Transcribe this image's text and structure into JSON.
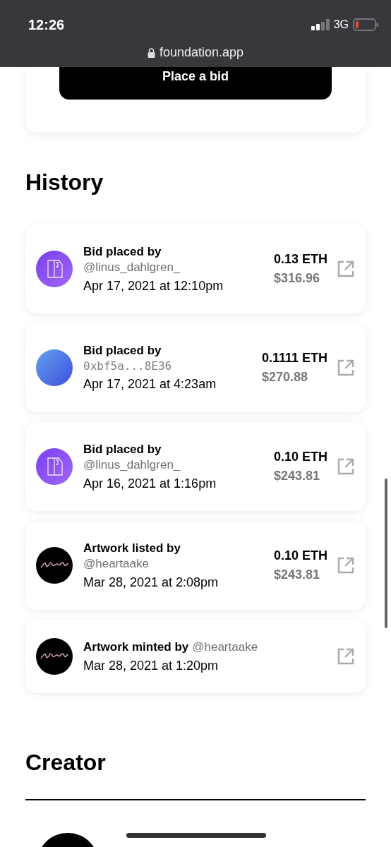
{
  "status_bar": {
    "time": "12:26",
    "network": "3G"
  },
  "browser": {
    "url": "foundation.app"
  },
  "bid_button": {
    "label": "Place a bid"
  },
  "history": {
    "title": "History",
    "items": [
      {
        "kind": "stacked",
        "avatar": {
          "kind": "logo"
        },
        "action": "Bid placed by",
        "actor": {
          "kind": "handle",
          "text": "@linus_dahlgren_"
        },
        "date": "Apr 17, 2021 at 12:10pm",
        "eth": "0.13 ETH",
        "usd": "$316.96"
      },
      {
        "kind": "stacked",
        "avatar": {
          "kind": "gradient"
        },
        "action": "Bid placed by",
        "actor": {
          "kind": "address",
          "text": "0xbf5a...8E36"
        },
        "date": "Apr 17, 2021 at 4:23am",
        "eth": "0.1111 ETH",
        "usd": "$270.88"
      },
      {
        "kind": "stacked",
        "avatar": {
          "kind": "logo"
        },
        "action": "Bid placed by",
        "actor": {
          "kind": "handle",
          "text": "@linus_dahlgren_"
        },
        "date": "Apr 16, 2021 at 1:16pm",
        "eth": "0.10 ETH",
        "usd": "$243.81"
      },
      {
        "kind": "stacked",
        "avatar": {
          "kind": "script"
        },
        "action": "Artwork listed by",
        "actor": {
          "kind": "handle",
          "text": "@heartaake"
        },
        "date": "Mar 28, 2021 at 2:08pm",
        "eth": "0.10 ETH",
        "usd": "$243.81"
      },
      {
        "kind": "inline",
        "avatar": {
          "kind": "script"
        },
        "action": "Artwork minted by",
        "actor": {
          "kind": "handle",
          "text": "@heartaake"
        },
        "date": "Mar 28, 2021 at 1:20pm"
      }
    ]
  },
  "creator": {
    "title": "Creator"
  }
}
